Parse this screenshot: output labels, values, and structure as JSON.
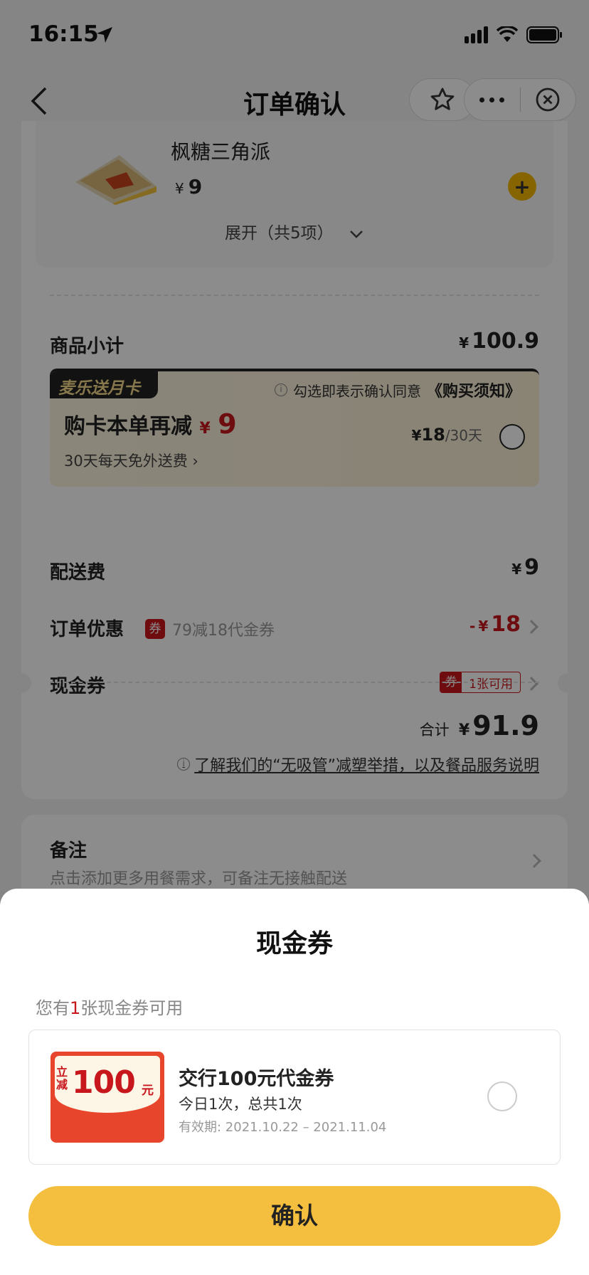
{
  "status": {
    "time": "16:15"
  },
  "nav": {
    "title": "订单确认"
  },
  "item": {
    "name": "枫糖三角派",
    "currency": "¥",
    "price": "9",
    "expand": "展开（共5项）"
  },
  "summary": {
    "subtotal_label": "商品小计",
    "subtotal_currency": "¥",
    "subtotal_value": "100.9",
    "delivery_label": "配送费",
    "delivery_currency": "¥",
    "delivery_value": "9",
    "discount_label": "订单优惠",
    "discount_tag": "券",
    "discount_desc": "79减18代金券",
    "discount_sign": "-",
    "discount_currency": "¥",
    "discount_value": "18",
    "cash_label": "现金券",
    "cash_tag_icon": "券",
    "cash_tag_text": "1张可用",
    "total_label": "合计",
    "total_currency": "¥",
    "total_value": "91.9",
    "notice_icon": "i",
    "notice_link": "了解我们的“无吸管”减塑举措，以及餐品服务说明"
  },
  "promo": {
    "badge": "麦乐送月卡",
    "notice_icon": "i",
    "notice_text": "勾选即表示确认同意",
    "notice_link": "《购买须知》",
    "main_text": "购卡本单再减",
    "main_currency": "¥",
    "main_value": "9",
    "sub_text": "30天每天免外送费 ›",
    "price": "18",
    "price_currency": "¥",
    "price_unit": "/30天"
  },
  "remark": {
    "label": "备注",
    "hint": "点击添加更多用餐需求，可备注无接触配送"
  },
  "sheet": {
    "title": "现金券",
    "count_prefix": "您有",
    "count": "1",
    "count_suffix": "张现金券可用",
    "voucher": {
      "img_li": "立减",
      "img_amount": "100",
      "img_unit": "元",
      "name": "交行100元代金券",
      "times": "今日1次，总共1次",
      "valid": "有效期: 2021.10.22 – 2021.11.04"
    },
    "confirm": "确认"
  },
  "colors": {
    "brand_yellow": "#f4be3e",
    "accent_red": "#c8161d"
  }
}
